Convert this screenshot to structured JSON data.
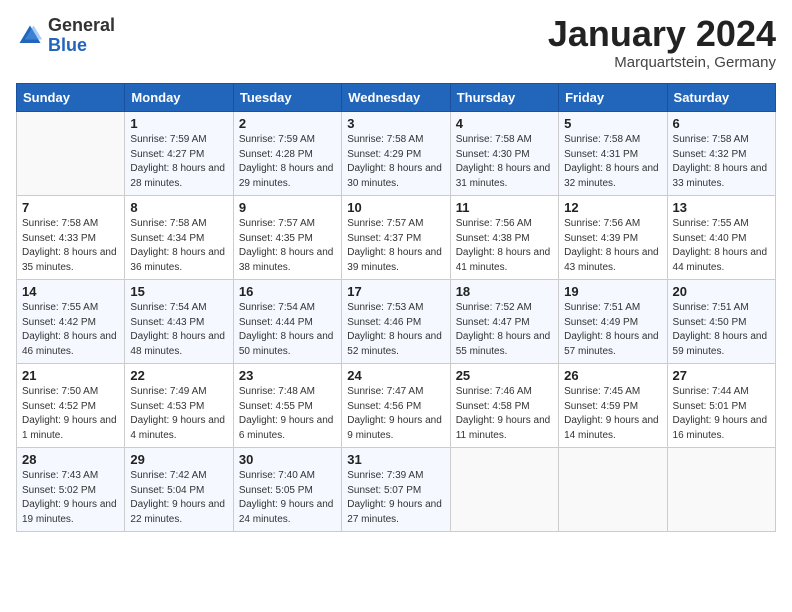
{
  "logo": {
    "general": "General",
    "blue": "Blue"
  },
  "title": {
    "month_year": "January 2024",
    "location": "Marquartstein, Germany"
  },
  "headers": [
    "Sunday",
    "Monday",
    "Tuesday",
    "Wednesday",
    "Thursday",
    "Friday",
    "Saturday"
  ],
  "weeks": [
    [
      {
        "day": "",
        "sunrise": "",
        "sunset": "",
        "daylight": ""
      },
      {
        "day": "1",
        "sunrise": "Sunrise: 7:59 AM",
        "sunset": "Sunset: 4:27 PM",
        "daylight": "Daylight: 8 hours and 28 minutes."
      },
      {
        "day": "2",
        "sunrise": "Sunrise: 7:59 AM",
        "sunset": "Sunset: 4:28 PM",
        "daylight": "Daylight: 8 hours and 29 minutes."
      },
      {
        "day": "3",
        "sunrise": "Sunrise: 7:58 AM",
        "sunset": "Sunset: 4:29 PM",
        "daylight": "Daylight: 8 hours and 30 minutes."
      },
      {
        "day": "4",
        "sunrise": "Sunrise: 7:58 AM",
        "sunset": "Sunset: 4:30 PM",
        "daylight": "Daylight: 8 hours and 31 minutes."
      },
      {
        "day": "5",
        "sunrise": "Sunrise: 7:58 AM",
        "sunset": "Sunset: 4:31 PM",
        "daylight": "Daylight: 8 hours and 32 minutes."
      },
      {
        "day": "6",
        "sunrise": "Sunrise: 7:58 AM",
        "sunset": "Sunset: 4:32 PM",
        "daylight": "Daylight: 8 hours and 33 minutes."
      }
    ],
    [
      {
        "day": "7",
        "sunrise": "Sunrise: 7:58 AM",
        "sunset": "Sunset: 4:33 PM",
        "daylight": "Daylight: 8 hours and 35 minutes."
      },
      {
        "day": "8",
        "sunrise": "Sunrise: 7:58 AM",
        "sunset": "Sunset: 4:34 PM",
        "daylight": "Daylight: 8 hours and 36 minutes."
      },
      {
        "day": "9",
        "sunrise": "Sunrise: 7:57 AM",
        "sunset": "Sunset: 4:35 PM",
        "daylight": "Daylight: 8 hours and 38 minutes."
      },
      {
        "day": "10",
        "sunrise": "Sunrise: 7:57 AM",
        "sunset": "Sunset: 4:37 PM",
        "daylight": "Daylight: 8 hours and 39 minutes."
      },
      {
        "day": "11",
        "sunrise": "Sunrise: 7:56 AM",
        "sunset": "Sunset: 4:38 PM",
        "daylight": "Daylight: 8 hours and 41 minutes."
      },
      {
        "day": "12",
        "sunrise": "Sunrise: 7:56 AM",
        "sunset": "Sunset: 4:39 PM",
        "daylight": "Daylight: 8 hours and 43 minutes."
      },
      {
        "day": "13",
        "sunrise": "Sunrise: 7:55 AM",
        "sunset": "Sunset: 4:40 PM",
        "daylight": "Daylight: 8 hours and 44 minutes."
      }
    ],
    [
      {
        "day": "14",
        "sunrise": "Sunrise: 7:55 AM",
        "sunset": "Sunset: 4:42 PM",
        "daylight": "Daylight: 8 hours and 46 minutes."
      },
      {
        "day": "15",
        "sunrise": "Sunrise: 7:54 AM",
        "sunset": "Sunset: 4:43 PM",
        "daylight": "Daylight: 8 hours and 48 minutes."
      },
      {
        "day": "16",
        "sunrise": "Sunrise: 7:54 AM",
        "sunset": "Sunset: 4:44 PM",
        "daylight": "Daylight: 8 hours and 50 minutes."
      },
      {
        "day": "17",
        "sunrise": "Sunrise: 7:53 AM",
        "sunset": "Sunset: 4:46 PM",
        "daylight": "Daylight: 8 hours and 52 minutes."
      },
      {
        "day": "18",
        "sunrise": "Sunrise: 7:52 AM",
        "sunset": "Sunset: 4:47 PM",
        "daylight": "Daylight: 8 hours and 55 minutes."
      },
      {
        "day": "19",
        "sunrise": "Sunrise: 7:51 AM",
        "sunset": "Sunset: 4:49 PM",
        "daylight": "Daylight: 8 hours and 57 minutes."
      },
      {
        "day": "20",
        "sunrise": "Sunrise: 7:51 AM",
        "sunset": "Sunset: 4:50 PM",
        "daylight": "Daylight: 8 hours and 59 minutes."
      }
    ],
    [
      {
        "day": "21",
        "sunrise": "Sunrise: 7:50 AM",
        "sunset": "Sunset: 4:52 PM",
        "daylight": "Daylight: 9 hours and 1 minute."
      },
      {
        "day": "22",
        "sunrise": "Sunrise: 7:49 AM",
        "sunset": "Sunset: 4:53 PM",
        "daylight": "Daylight: 9 hours and 4 minutes."
      },
      {
        "day": "23",
        "sunrise": "Sunrise: 7:48 AM",
        "sunset": "Sunset: 4:55 PM",
        "daylight": "Daylight: 9 hours and 6 minutes."
      },
      {
        "day": "24",
        "sunrise": "Sunrise: 7:47 AM",
        "sunset": "Sunset: 4:56 PM",
        "daylight": "Daylight: 9 hours and 9 minutes."
      },
      {
        "day": "25",
        "sunrise": "Sunrise: 7:46 AM",
        "sunset": "Sunset: 4:58 PM",
        "daylight": "Daylight: 9 hours and 11 minutes."
      },
      {
        "day": "26",
        "sunrise": "Sunrise: 7:45 AM",
        "sunset": "Sunset: 4:59 PM",
        "daylight": "Daylight: 9 hours and 14 minutes."
      },
      {
        "day": "27",
        "sunrise": "Sunrise: 7:44 AM",
        "sunset": "Sunset: 5:01 PM",
        "daylight": "Daylight: 9 hours and 16 minutes."
      }
    ],
    [
      {
        "day": "28",
        "sunrise": "Sunrise: 7:43 AM",
        "sunset": "Sunset: 5:02 PM",
        "daylight": "Daylight: 9 hours and 19 minutes."
      },
      {
        "day": "29",
        "sunrise": "Sunrise: 7:42 AM",
        "sunset": "Sunset: 5:04 PM",
        "daylight": "Daylight: 9 hours and 22 minutes."
      },
      {
        "day": "30",
        "sunrise": "Sunrise: 7:40 AM",
        "sunset": "Sunset: 5:05 PM",
        "daylight": "Daylight: 9 hours and 24 minutes."
      },
      {
        "day": "31",
        "sunrise": "Sunrise: 7:39 AM",
        "sunset": "Sunset: 5:07 PM",
        "daylight": "Daylight: 9 hours and 27 minutes."
      },
      {
        "day": "",
        "sunrise": "",
        "sunset": "",
        "daylight": ""
      },
      {
        "day": "",
        "sunrise": "",
        "sunset": "",
        "daylight": ""
      },
      {
        "day": "",
        "sunrise": "",
        "sunset": "",
        "daylight": ""
      }
    ]
  ]
}
